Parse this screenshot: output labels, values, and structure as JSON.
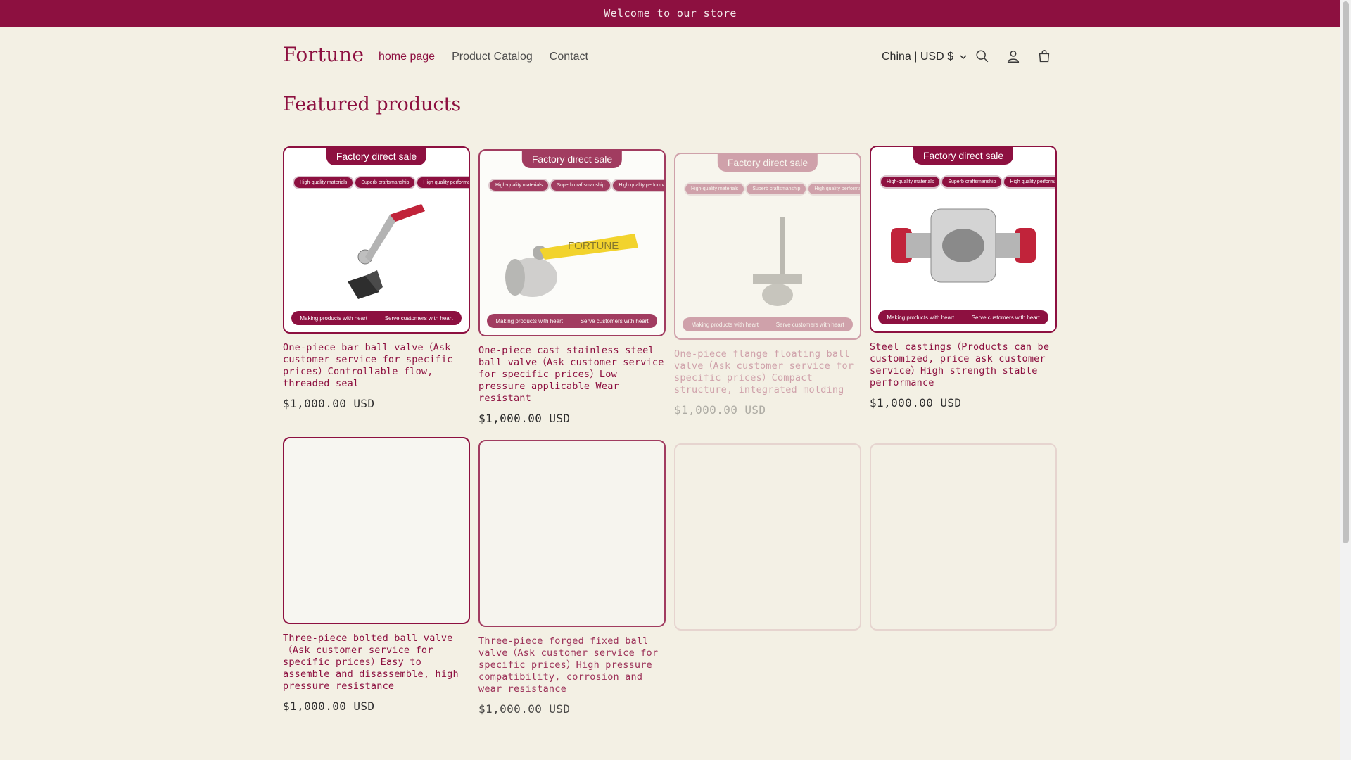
{
  "announcement": {
    "text": "Welcome to our store"
  },
  "header": {
    "logo": "Fortune",
    "nav": [
      "home page",
      "Product Catalog",
      "Contact"
    ],
    "locale": "China | USD $",
    "icons": [
      "search-icon",
      "account-icon",
      "cart-icon"
    ]
  },
  "section": {
    "title": "Featured products"
  },
  "promo_text": {
    "banner": "Factory direct sale",
    "tags": [
      "High-quality materials",
      "Superb craftsmanship",
      "High quality performance"
    ],
    "footer": [
      "Making products with heart",
      "Serve customers with heart"
    ],
    "brand": "FORTUNE"
  },
  "products": [
    {
      "title": "One-piece bar ball valve（Ask customer service for specific prices）Controllable flow, threaded seal",
      "price": "$1,000.00 USD"
    },
    {
      "title": "One-piece cast stainless steel ball valve（Ask customer service for specific prices）Low pressure applicable Wear resistant",
      "price": "$1,000.00 USD"
    },
    {
      "title": "One-piece flange floating ball valve（Ask customer service for specific prices）Compact structure, integrated molding",
      "price": "$1,000.00 USD"
    },
    {
      "title": "Steel castings（Products can be customized, price ask customer service）High strength stable performance",
      "price": "$1,000.00 USD"
    },
    {
      "title": "Three-piece bolted ball valve（Ask customer service for specific prices）Easy to assemble and disassemble, high pressure resistance",
      "price": "$1,000.00 USD"
    },
    {
      "title": "Three-piece forged fixed ball valve（Ask customer service for specific prices）High pressure compatibility, corrosion and wear resistance",
      "price": "$1,000.00 USD"
    },
    {
      "title": "",
      "price": ""
    },
    {
      "title": "",
      "price": ""
    }
  ],
  "colors": {
    "brand": "#8d1040",
    "background": "#f3f0e4",
    "accent_yellow": "#f2cc00"
  }
}
